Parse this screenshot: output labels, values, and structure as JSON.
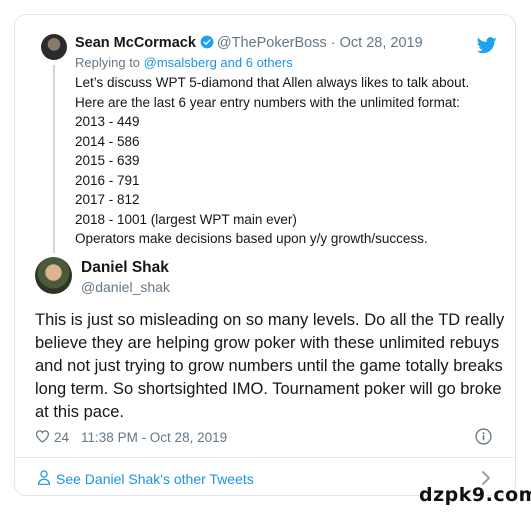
{
  "quoted_tweet": {
    "author_name": "Sean McCormack",
    "author_handle": "@ThePokerBoss",
    "separator": "·",
    "date": "Oct 28, 2019",
    "reply_prefix": "Replying to ",
    "reply_targets": "@msalsberg and 6 others",
    "lines": [
      "Let’s discuss WPT 5-diamond that Allen always likes to talk about.",
      "Here are the last 6 year entry numbers with the unlimited format:",
      "2013 - 449",
      "2014 - 586",
      "2015 - 639",
      "2016 - 791",
      "2017 - 812",
      "2018 - 1001 (largest WPT main ever)",
      "Operators make decisions based upon y/y growth/success."
    ]
  },
  "main_tweet": {
    "author_name": "Daniel Shak",
    "author_handle": "@daniel_shak",
    "lines": [
      "This is just so misleading on so many levels. Do all the TD really",
      "believe they are helping grow poker with these unlimited rebuys",
      "and not just trying to grow numbers until the game totally breaks",
      "long term. So shortsighted IMO. Tournament poker will go broke",
      "at this pace."
    ],
    "likes": "24",
    "timestamp": "11:38 PM - Oct 28, 2019"
  },
  "footer": {
    "see_more_label": "See Daniel Shak's other Tweets"
  },
  "watermark": "dzpk9.com",
  "icons": {
    "verified": "verified-badge-icon",
    "brand": "twitter-bird-icon",
    "like": "heart-icon",
    "info": "info-icon",
    "profile": "person-icon",
    "chevron": "chevron-right-icon"
  },
  "colors": {
    "accent": "#1b95e0",
    "muted": "#657786",
    "text": "#14171a",
    "border": "#e1e8ed"
  }
}
